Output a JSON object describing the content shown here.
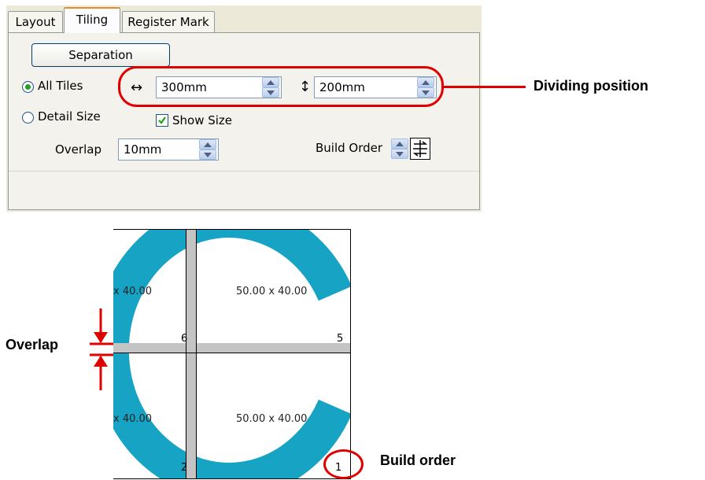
{
  "tabs": [
    {
      "label": "Layout",
      "active": false
    },
    {
      "label": "Tiling",
      "active": true
    },
    {
      "label": "Register Mark",
      "active": false
    }
  ],
  "separation_button": "Separation",
  "tile_mode": {
    "all_tiles_label": "All Tiles",
    "detail_size_label": "Detail Size",
    "selected": "All Tiles"
  },
  "dividing": {
    "horizontal_icon": "↔",
    "horizontal_value": "300mm",
    "vertical_icon": "↕",
    "vertical_value": "200mm"
  },
  "show_size": {
    "label": "Show Size",
    "checked": true
  },
  "overlap": {
    "label": "Overlap",
    "value": "10mm"
  },
  "build_order": {
    "label": "Build Order",
    "icon": "build-order-icon"
  },
  "annotations": {
    "dividing_position": "Dividing position",
    "overlap": "Overlap",
    "build_order": "Build order"
  },
  "preview": {
    "tiles": [
      {
        "size": "x 40.00",
        "number": "6"
      },
      {
        "size": "50.00 x 40.00",
        "number": "5"
      },
      {
        "size": "x 40.00",
        "number": "2"
      },
      {
        "size": "50.00 x 40.00",
        "number": "1"
      }
    ],
    "letter_color": "#16a3c4"
  },
  "colors": {
    "accent_red": "#e10000",
    "tab_accent": "#e68b2c",
    "radio_dot": "#21a121"
  }
}
